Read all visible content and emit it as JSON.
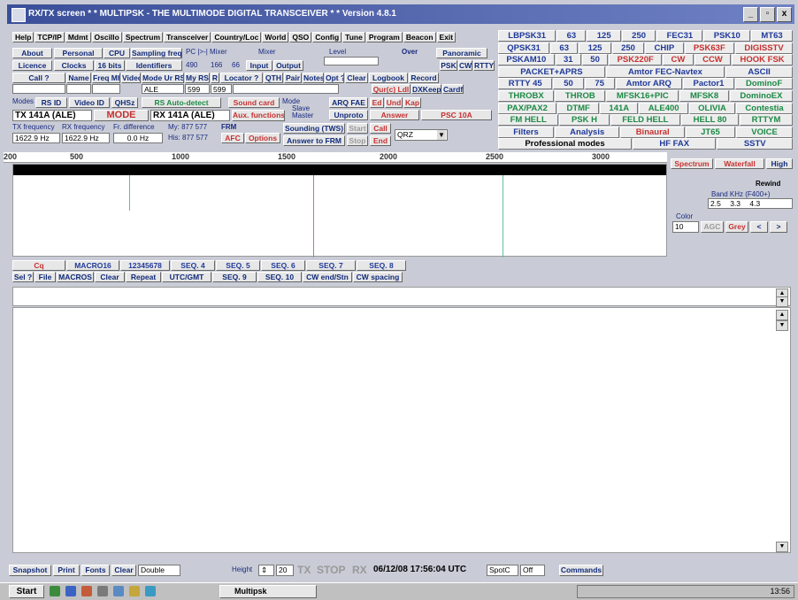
{
  "window": {
    "title": "RX/TX screen  * * MULTIPSK - THE MULTIMODE DIGITAL TRANSCEIVER * *  Version 4.8.1",
    "controls": [
      "_",
      "▫",
      "x"
    ]
  },
  "toolbar_top": [
    "Help",
    "TCP/IP",
    "Mdmt",
    "Oscillo",
    "Spectrum",
    "Transceiver",
    "Country/Loc",
    "World",
    "QSO",
    "Config",
    "Tune",
    "Program",
    "Beacon",
    "Exit"
  ],
  "row2": {
    "about": "About",
    "personal": "Personal",
    "cpu": "CPU",
    "sampling": "Sampling freq",
    "pc_label": "PC |>-| Mixer",
    "mixer": "Mixer",
    "level": "Level",
    "over": "Over",
    "panoramic": "Panoramic"
  },
  "row3": {
    "licence": "Licence",
    "clocks": "Clocks",
    "bits": "16 bits",
    "identifiers": "Identifiers",
    "opt1": "490",
    "opt2": "166",
    "opt3": "66",
    "input": "Input",
    "output": "Output",
    "psk": "PSK",
    "cw": "CW",
    "rtty": "RTTY"
  },
  "row4": {
    "call": "Call ?",
    "name": "Name",
    "freq": "Freq Mhz",
    "video": "Video",
    "mode_ur": "Mode Ur RST",
    "my_rst": "My RST",
    "r": "R",
    "locator": "Locator ?",
    "qth": "QTH",
    "pair": "Pair",
    "notes": "Notes",
    "opt": "Opt ?",
    "clear": "Clear",
    "logbook": "Logbook",
    "record": "Record"
  },
  "row5": {
    "ale": "ALE",
    "v1": "599",
    "v2": "599",
    "ququl": "Qur(c) Ldl",
    "dxkeeper": "DXKeeper",
    "cardf": "Cardf"
  },
  "modes_panel": {
    "modes_label": "Modes",
    "rs_id": "RS ID",
    "video_id": "Video ID",
    "qhsz": "QHSz",
    "rs_auto": "RS Auto-detect",
    "sound_card": "Sound card",
    "mode_label": "Mode",
    "slave": "Slave",
    "master": "Master",
    "arq_fae": "ARQ FAE",
    "ed": "Ed",
    "und": "Und",
    "kap": "Kap",
    "tx_mode": "TX 141A (ALE)",
    "mode_btn": "MODE",
    "rx_mode": "RX 141A (ALE)",
    "aux_functions": "Aux. functions",
    "unproto": "Unproto",
    "answer": "Answer",
    "psc": "PSC 10A",
    "tx_freq_label": "TX frequency",
    "rx_freq_label": "RX frequency",
    "diff_label": "Fr. difference",
    "my_label": "My: 877 577",
    "frm": "FRM",
    "tx_freq": "1622.9 Hz",
    "rx_freq": "1622.9 Hz",
    "diff": "0.0 Hz",
    "his_label": "His: 877 577",
    "afc": "AFC",
    "options": "Options",
    "sounding": "Sounding (TWS)",
    "start": "Start",
    "call": "Call",
    "answer_frm": "Answer to FRM",
    "stop": "Stop",
    "end": "End",
    "qrz": "QRZ"
  },
  "mode_grid": [
    [
      {
        "t": "LBPSK31",
        "c": "b"
      },
      {
        "t": "63",
        "c": "b"
      },
      {
        "t": "125",
        "c": "b"
      },
      {
        "t": "250",
        "c": "b"
      },
      {
        "t": "FEC31",
        "c": "b"
      },
      {
        "t": "PSK10",
        "c": "b"
      },
      {
        "t": "MT63",
        "c": "b"
      }
    ],
    [
      {
        "t": "QPSK31",
        "c": "b"
      },
      {
        "t": "63",
        "c": "b"
      },
      {
        "t": "125",
        "c": "b"
      },
      {
        "t": "250",
        "c": "b"
      },
      {
        "t": "CHIP",
        "c": "b"
      },
      {
        "t": "PSK63F",
        "c": "r"
      },
      {
        "t": "DIGISSTV",
        "c": "r"
      }
    ],
    [
      {
        "t": "PSKAM10",
        "c": "b"
      },
      {
        "t": "31",
        "c": "b"
      },
      {
        "t": "50",
        "c": "b"
      },
      {
        "t": "PSK220F",
        "c": "r"
      },
      {
        "t": "CW",
        "c": "r"
      },
      {
        "t": "CCW",
        "c": "r"
      },
      {
        "t": "HOOK FSK",
        "c": "r"
      }
    ],
    [
      {
        "t": "PACKET+APRS",
        "c": "b"
      },
      {
        "t": "Amtor FEC-Navtex",
        "c": "b"
      },
      {
        "t": "ASCII",
        "c": "b"
      }
    ],
    [
      {
        "t": "RTTY 45",
        "c": "b"
      },
      {
        "t": "50",
        "c": "b"
      },
      {
        "t": "75",
        "c": "b"
      },
      {
        "t": "Amtor ARQ",
        "c": "b"
      },
      {
        "t": "Pactor1",
        "c": "b"
      },
      {
        "t": "DominoF",
        "c": "g"
      }
    ],
    [
      {
        "t": "THROBX",
        "c": "g"
      },
      {
        "t": "THROB",
        "c": "g"
      },
      {
        "t": "MFSK16+PIC",
        "c": "g"
      },
      {
        "t": "MFSK8",
        "c": "g"
      },
      {
        "t": "DominoEX",
        "c": "g"
      }
    ],
    [
      {
        "t": "PAX/PAX2",
        "c": "g"
      },
      {
        "t": "DTMF",
        "c": "g"
      },
      {
        "t": "141A",
        "c": "g"
      },
      {
        "t": "ALE400",
        "c": "g"
      },
      {
        "t": "OLIVIA",
        "c": "g"
      },
      {
        "t": "Contestia",
        "c": "g"
      }
    ],
    [
      {
        "t": "FM HELL",
        "c": "g"
      },
      {
        "t": "PSK H",
        "c": "g"
      },
      {
        "t": "FELD HELL",
        "c": "g"
      },
      {
        "t": "HELL 80",
        "c": "g"
      },
      {
        "t": "RTTYM",
        "c": "g"
      }
    ],
    [
      {
        "t": "Filters",
        "c": "b"
      },
      {
        "t": "Analysis",
        "c": "b"
      },
      {
        "t": "Binaural",
        "c": "r"
      },
      {
        "t": "JT65",
        "c": "g"
      },
      {
        "t": "VOICE",
        "c": "g"
      }
    ],
    [
      {
        "t": "Professional modes",
        "c": "k"
      },
      {
        "t": "HF FAX",
        "c": "b"
      },
      {
        "t": "SSTV",
        "c": "b"
      }
    ]
  ],
  "scale": {
    "ticks": [
      "200",
      "500",
      "1000",
      "1500",
      "2000",
      "2500",
      "3000"
    ]
  },
  "right_panel": {
    "spectrum": "Spectrum",
    "waterfall": "Waterfall",
    "high": "High",
    "rewind": "Rewind",
    "band_label": "Band KHz (F400+)",
    "b1": "2.5",
    "b2": "3.3",
    "b3": "4.3",
    "color_label": "Color",
    "color_val": "10",
    "agc": "AGC",
    "grey": "Grey",
    "left": "<",
    "right": ">"
  },
  "memories": {
    "row1": [
      "Cq",
      "MACRO16",
      "12345678",
      "SEQ. 4",
      "SEQ. 5",
      "SEQ. 6",
      "SEQ. 7",
      "SEQ. 8"
    ],
    "row2": [
      "Sel ?",
      "File",
      "MACROS",
      "Clear",
      "Repeat",
      "UTC/GMT",
      "SEQ. 9",
      "SEQ. 10",
      "CW end/Stn",
      "CW spacing"
    ]
  },
  "status": {
    "snapshot": "Snapshot",
    "print": "Print",
    "fonts": "Fonts",
    "clear": "Clear",
    "double": "Double",
    "height_label": "Height",
    "height_val": "20",
    "tx": "TX",
    "stop": "STOP",
    "rx": "RX",
    "datetime": "06/12/08 17:56:04 UTC",
    "spot": "SpotC",
    "off": "Off",
    "commands": "Commands"
  },
  "taskbar": {
    "start": "Start",
    "task": "Multipsk",
    "clock": "13:56"
  }
}
